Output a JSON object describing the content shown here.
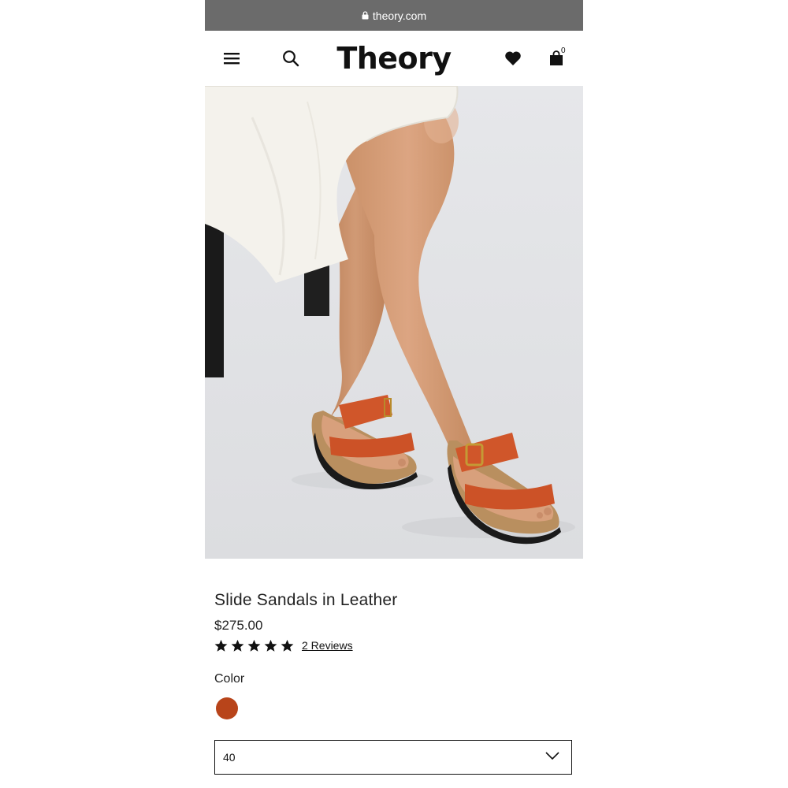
{
  "browser": {
    "url": "theory.com"
  },
  "header": {
    "logo": "Theory",
    "cart_count": "0"
  },
  "icons": {
    "lock": "lock-icon",
    "menu": "hamburger-menu-icon",
    "search": "search-icon",
    "wishlist": "heart-icon",
    "cart": "shopping-bag-icon",
    "chevron": "chevron-down-icon",
    "star": "star-icon"
  },
  "product": {
    "title": "Slide Sandals in Leather",
    "price": "$275.00",
    "rating": 5,
    "reviews_label": "2 Reviews",
    "color_label": "Color",
    "color_swatch": "#b8441a",
    "size_value": "40"
  },
  "colors": {
    "urlbar": "#6b6b6b",
    "text": "#222222",
    "sandal_strap": "#d0562a"
  }
}
